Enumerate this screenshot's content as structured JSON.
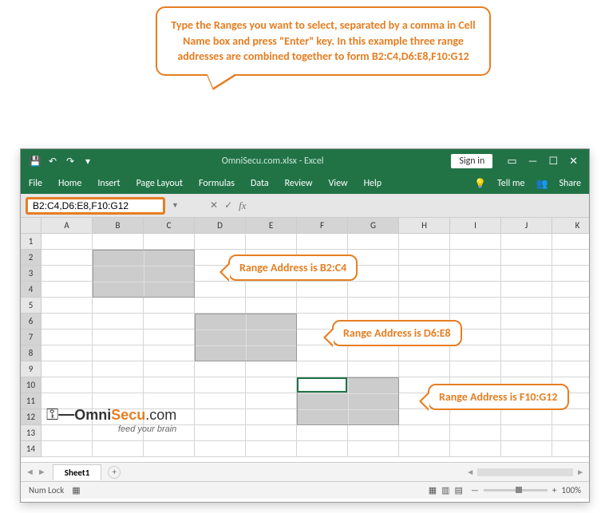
{
  "callout_top": "Type the Ranges you want to select, separated by a comma in Cell Name box and press \"Enter\" key. In this example three range addresses are combined together to form B2:C4,D6:E8,F10:G12",
  "titlebar": {
    "title": "OmniSecu.com.xlsx - Excel",
    "signin": "Sign in"
  },
  "tabs": {
    "file": "File",
    "home": "Home",
    "insert": "Insert",
    "page_layout": "Page Layout",
    "formulas": "Formulas",
    "data": "Data",
    "review": "Review",
    "view": "View",
    "help": "Help",
    "tellme": "Tell me",
    "share": "Share"
  },
  "name_box": "B2:C4,D6:E8,F10:G12",
  "fx_label": "fx",
  "columns": [
    "A",
    "B",
    "C",
    "D",
    "E",
    "F",
    "G",
    "H",
    "I",
    "J",
    "K"
  ],
  "rows": [
    "1",
    "2",
    "3",
    "4",
    "5",
    "6",
    "7",
    "8",
    "9",
    "10",
    "11",
    "12",
    "13",
    "14"
  ],
  "annotations": {
    "r1": "Range Address is B2:C4",
    "r2": "Range Address is D6:E8",
    "r3": "Range Address is F10:G12"
  },
  "logo": {
    "omni": "Omni",
    "secu": "Secu",
    "dotcom": ".com",
    "tagline": "feed your brain"
  },
  "sheet_tab": "Sheet1",
  "statusbar": {
    "numlock": "Num Lock",
    "zoom": "100%"
  },
  "chart_data": null
}
